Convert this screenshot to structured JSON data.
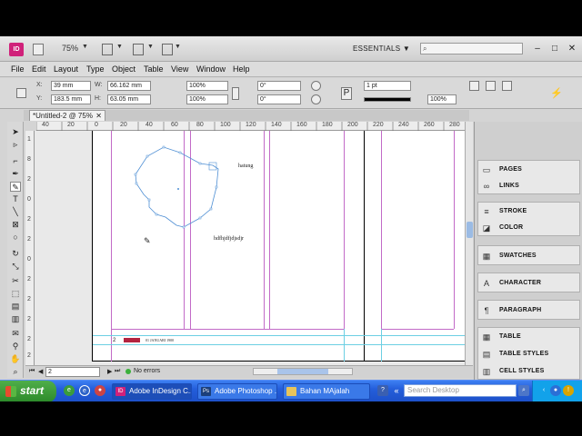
{
  "app": {
    "logo": "ID",
    "zoom": "75%",
    "workspace": "ESSENTIALS",
    "search_placeholder": ""
  },
  "menu": [
    "File",
    "Edit",
    "Layout",
    "Type",
    "Object",
    "Table",
    "View",
    "Window",
    "Help"
  ],
  "control_panel": {
    "x_label": "X:",
    "x_value": "39 mm",
    "y_label": "Y:",
    "y_value": "183.5 mm",
    "w_label": "W:",
    "w_value": "66.162 mm",
    "h_label": "H:",
    "h_value": "63.05 mm",
    "scale_x": "100%",
    "scale_y": "100%",
    "rotate": "0°",
    "shear": "0°",
    "stroke_weight": "1 pt",
    "opacity": "100%"
  },
  "document": {
    "tab_title": "*Untitled-2 @ 75%",
    "hruler_ticks": [
      "40",
      "20",
      "0",
      "20",
      "40",
      "60",
      "80",
      "100",
      "120",
      "140",
      "160",
      "180",
      "200",
      "220",
      "240",
      "260",
      "280"
    ],
    "vruler_ticks": [
      "1",
      "8",
      "2",
      "0",
      "2",
      "2",
      "0",
      "2",
      "2",
      "2",
      "2",
      "2"
    ],
    "text_hatung": "hatung",
    "text_misc": "hdfhjdfjdjsdjr",
    "footer_page_number": "2",
    "footer_text": "01 JANUARI 1900"
  },
  "status": {
    "page": "2",
    "errors": "No errors"
  },
  "panels": [
    {
      "items": [
        {
          "icon": "pages-icon",
          "label": "PAGES"
        },
        {
          "icon": "links-icon",
          "label": "LINKS"
        }
      ]
    },
    {
      "items": [
        {
          "icon": "stroke-icon",
          "label": "STROKE"
        },
        {
          "icon": "color-icon",
          "label": "COLOR"
        }
      ]
    },
    {
      "items": [
        {
          "icon": "swatches-icon",
          "label": "SWATCHES"
        }
      ]
    },
    {
      "items": [
        {
          "icon": "character-icon",
          "label": "CHARACTER"
        }
      ]
    },
    {
      "items": [
        {
          "icon": "paragraph-icon",
          "label": "PARAGRAPH"
        }
      ]
    },
    {
      "items": [
        {
          "icon": "table-icon",
          "label": "TABLE"
        },
        {
          "icon": "table-styles-icon",
          "label": "TABLE STYLES"
        },
        {
          "icon": "cell-styles-icon",
          "label": "CELL STYLES"
        }
      ]
    }
  ],
  "taskbar": {
    "start": "start",
    "tasks": [
      "Adobe InDesign C...",
      "Adobe Photoshop ...",
      "Bahan MAjalah"
    ],
    "desktop_search": "Search Desktop"
  },
  "colors": {
    "accent_indesign": "#d0217a",
    "guide_magenta": "#c26ac7",
    "guide_cyan": "#6ccfe3",
    "taskbar_blue": "#245edb"
  }
}
